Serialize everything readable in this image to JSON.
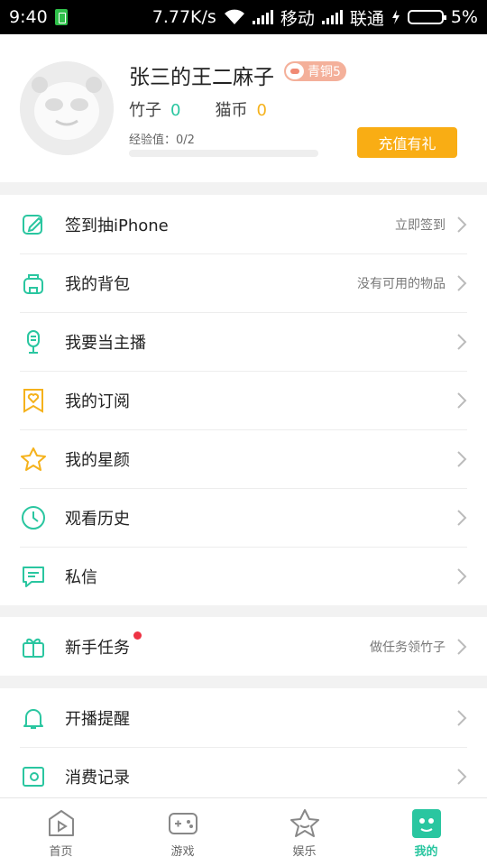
{
  "status_bar": {
    "time": "9:40",
    "speed": "7.77K/s",
    "carrier1": "移动",
    "carrier2": "联通",
    "battery": "5%"
  },
  "profile": {
    "nickname": "张三的王二麻子",
    "level_badge": "青铜5",
    "bamboo_label": "竹子",
    "bamboo_value": "0",
    "coin_label": "猫币",
    "coin_value": "0",
    "exp_label": "经验值：0/2",
    "exp_progress": 0,
    "recharge_button": "充值有礼"
  },
  "menu_group1": [
    {
      "label": "签到抽iPhone",
      "hint": "立即签到",
      "icon": "edit-icon"
    },
    {
      "label": "我的背包",
      "hint": "没有可用的物品",
      "icon": "backpack-icon"
    },
    {
      "label": "我要当主播",
      "hint": "",
      "icon": "microphone-icon"
    },
    {
      "label": "我的订阅",
      "hint": "",
      "icon": "subscription-heart-icon"
    },
    {
      "label": "我的星颜",
      "hint": "",
      "icon": "star-icon"
    },
    {
      "label": "观看历史",
      "hint": "",
      "icon": "clock-icon"
    },
    {
      "label": "私信",
      "hint": "",
      "icon": "message-icon"
    }
  ],
  "menu_group2": [
    {
      "label": "新手任务",
      "hint": "做任务领竹子",
      "icon": "gift-icon"
    }
  ],
  "menu_group3": [
    {
      "label": "开播提醒",
      "hint": "",
      "icon": "bell-icon"
    },
    {
      "label": "消费记录",
      "hint": "",
      "icon": "wallet-icon"
    }
  ],
  "tabs": [
    {
      "label": "首页",
      "icon": "home-play-icon"
    },
    {
      "label": "游戏",
      "icon": "gamepad-icon"
    },
    {
      "label": "娱乐",
      "icon": "star-badge-icon"
    },
    {
      "label": "我的",
      "icon": "panda-icon"
    }
  ],
  "colors": {
    "accent": "#2ac6a0",
    "orange": "#f9ad14",
    "red_dot": "#ee3344"
  }
}
